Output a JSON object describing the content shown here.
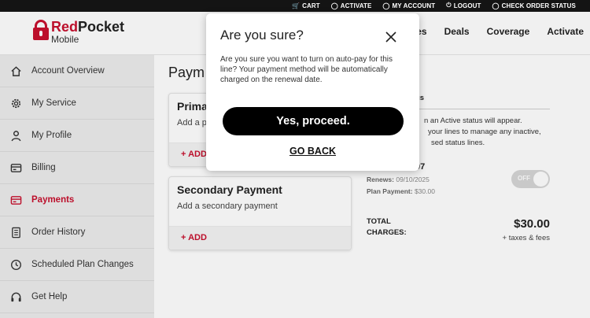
{
  "topbar": {
    "links": [
      {
        "label": "CART",
        "icon": "cart-icon"
      },
      {
        "label": "ACTIVATE",
        "icon": "check-circle-icon"
      },
      {
        "label": "MY ACCOUNT",
        "icon": "user-circle-icon"
      },
      {
        "label": "LOGOUT",
        "icon": "power-icon"
      },
      {
        "label": "CHECK ORDER STATUS",
        "icon": "check-circle-icon"
      }
    ]
  },
  "brand": {
    "name_red": "Red",
    "name_black": "Pocket",
    "sub": "Mobile",
    "color": "#c8102e"
  },
  "nav": {
    "items": [
      "nes",
      "Deals",
      "Coverage",
      "Activate"
    ]
  },
  "sidebar": {
    "items": [
      {
        "label": "Account Overview",
        "icon": "home-icon"
      },
      {
        "label": "My Service",
        "icon": "gear-icon"
      },
      {
        "label": "My Profile",
        "icon": "person-icon"
      },
      {
        "label": "Billing",
        "icon": "billing-icon"
      },
      {
        "label": "Payments",
        "icon": "card-icon",
        "active": true
      },
      {
        "label": "Order History",
        "icon": "document-icon"
      },
      {
        "label": "Scheduled Plan Changes",
        "icon": "clock-icon"
      },
      {
        "label": "Get Help",
        "icon": "headset-icon"
      }
    ]
  },
  "main": {
    "title": "Paym",
    "primary": {
      "title": "Prima",
      "sub": "Add a p",
      "add": "+ ADD"
    },
    "secondary": {
      "title": "Secondary Payment",
      "sub": "Add a secondary payment",
      "add": "+ ADD"
    },
    "right": {
      "heading": "us",
      "info": "n an Active status will appear.\nyour lines to manage any inactive,\nsed status lines.",
      "line_number": "07",
      "renews_label": "Renews:",
      "renews_value": "09/10/2025",
      "plan_label": "Plan Payment:",
      "plan_value": "$30.00",
      "toggle": "OFF",
      "total_label_1": "TOTAL",
      "total_label_2": "CHARGES:",
      "total_amount": "$30.00",
      "tax_note": "+ taxes & fees"
    }
  },
  "modal": {
    "title": "Are you sure?",
    "body": "Are you sure you want to turn on auto-pay for this line? Your payment method will be automatically charged on the renewal date.",
    "proceed": "Yes, proceed.",
    "back": "GO BACK"
  }
}
